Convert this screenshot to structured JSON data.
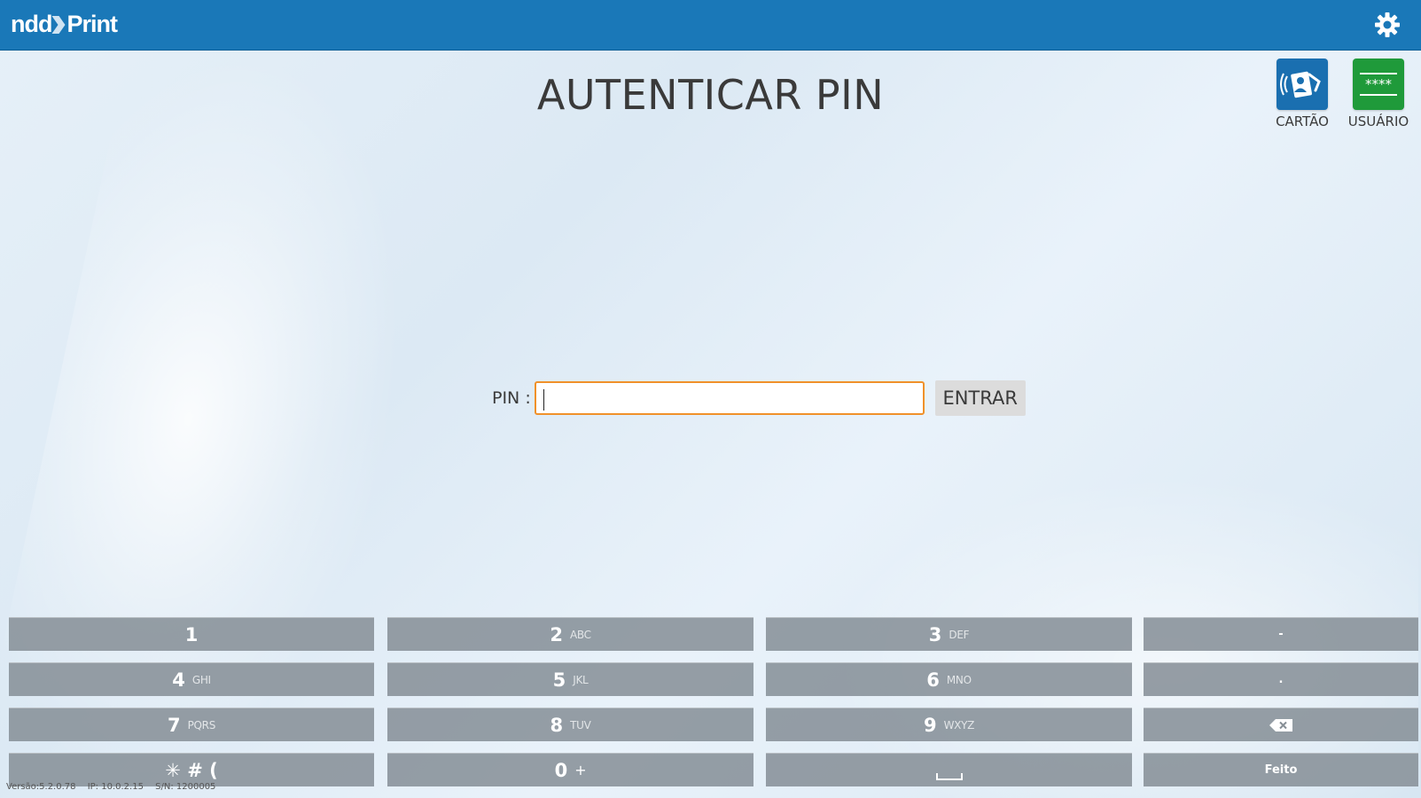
{
  "header": {
    "logo_left": "ndd",
    "logo_right": "Print",
    "bar_color": "#1a78b8",
    "settings_icon": "gear-icon"
  },
  "main": {
    "title": "AUTENTICAR PIN",
    "auth_modes": [
      {
        "label": "CARTÃO",
        "icon": "card-reader-icon",
        "color": "#1a6fb0"
      },
      {
        "label": "USUÁRIO",
        "icon": "password-icon",
        "color": "#1f9a3a",
        "icon_text": "****"
      }
    ],
    "pin_label": "PIN :",
    "pin_value": "",
    "enter_label": "ENTRAR",
    "input_border_color": "#f0912a"
  },
  "keyboard": {
    "rows": [
      [
        {
          "main": "1",
          "sub": ""
        },
        {
          "main": "2",
          "sub": "ABC"
        },
        {
          "main": "3",
          "sub": "DEF"
        },
        {
          "main": "-",
          "sub": ""
        }
      ],
      [
        {
          "main": "4",
          "sub": "GHI"
        },
        {
          "main": "5",
          "sub": "JKL"
        },
        {
          "main": "6",
          "sub": "MNO"
        },
        {
          "main": ".",
          "sub": ""
        }
      ],
      [
        {
          "main": "7",
          "sub": "PQRS"
        },
        {
          "main": "8",
          "sub": "TUV"
        },
        {
          "main": "9",
          "sub": "WXYZ"
        },
        {
          "main": "",
          "sub": "",
          "icon": "backspace-icon"
        }
      ],
      [
        {
          "main": "✳ # (",
          "sub": ""
        },
        {
          "main": "0",
          "sub": "+"
        },
        {
          "main": "",
          "sub": "",
          "icon": "space-icon"
        },
        {
          "main": "Feito",
          "sub": ""
        }
      ]
    ]
  },
  "footer": {
    "version": "Versão:5.2.0.78",
    "ip": "IP: 10.0.2.15",
    "serial": "S/N: 1200005"
  }
}
